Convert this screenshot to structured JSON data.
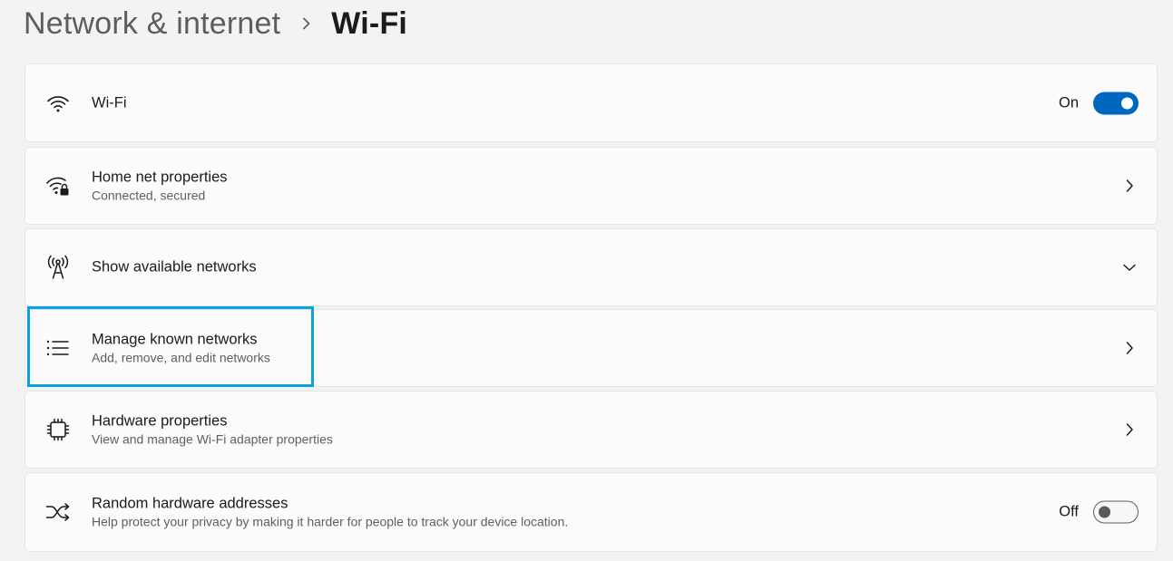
{
  "breadcrumb": {
    "parent": "Network & internet",
    "current": "Wi-Fi"
  },
  "items": [
    {
      "icon": "wifi-icon",
      "title": "Wi-Fi",
      "control": "toggle",
      "state_label": "On",
      "toggle_on": true
    },
    {
      "icon": "wifi-lock-icon",
      "title": "Home net properties",
      "subtitle": "Connected, secured",
      "control": "chevron-right"
    },
    {
      "icon": "antenna-icon",
      "title": "Show available networks",
      "control": "chevron-down"
    },
    {
      "icon": "list-icon",
      "title": "Manage known networks",
      "subtitle": "Add, remove, and edit networks",
      "control": "chevron-right",
      "highlighted": true
    },
    {
      "icon": "chip-icon",
      "title": "Hardware properties",
      "subtitle": "View and manage Wi-Fi adapter properties",
      "control": "chevron-right"
    },
    {
      "icon": "shuffle-icon",
      "title": "Random hardware addresses",
      "subtitle": "Help protect your privacy by making it harder for people to track your device location.",
      "control": "toggle",
      "state_label": "Off",
      "toggle_on": false
    }
  ],
  "colors": {
    "accent": "#0067c0",
    "highlight_border": "#0aa2dc",
    "page_bg": "#f3f3f3",
    "card_bg": "#fbfbfb"
  }
}
